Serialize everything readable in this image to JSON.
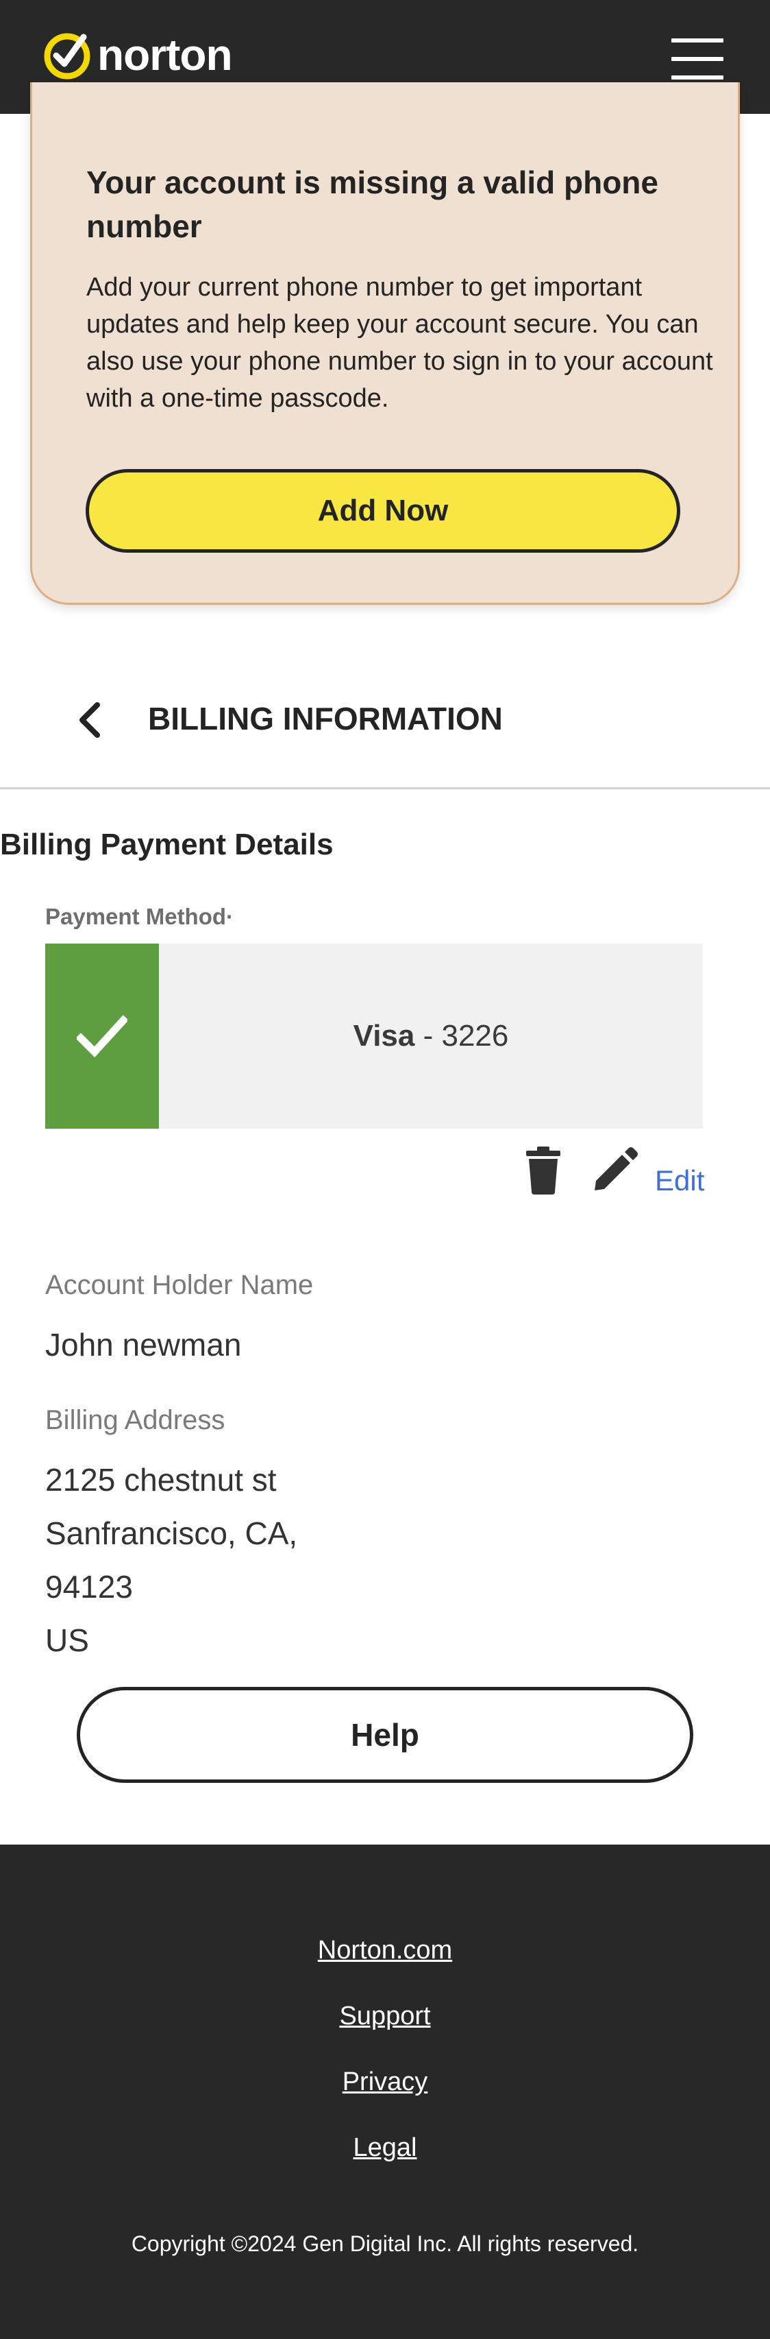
{
  "header": {
    "brand": "norton",
    "menu_icon": "hamburger-menu-icon"
  },
  "phone_alert": {
    "title": "Your account is missing a valid phone number",
    "body": "Add your current phone number to get important updates and help keep your account secure. You can also use your phone number to sign in to your account with a one-time passcode.",
    "button_label": "Add Now"
  },
  "billing": {
    "back_icon": "chevron-left-icon",
    "title": "BILLING INFORMATION",
    "section_heading": "Billing Payment Details",
    "payment_method_label": "Payment Method·",
    "payment": {
      "brand": "Visa",
      "separator": " - ",
      "last4": "3226",
      "selected_icon": "check-icon"
    },
    "actions": {
      "delete_icon": "trash-icon",
      "edit_icon": "pencil-icon",
      "edit_label": "Edit"
    },
    "account_holder_label": "Account Holder Name",
    "account_holder_value": "John newman",
    "billing_address_label": "Billing Address",
    "address_lines": [
      "2125 chestnut st",
      "Sanfrancisco, CA,",
      "94123",
      "US"
    ],
    "help_label": "Help"
  },
  "footer": {
    "links": [
      "Norton.com",
      "Support",
      "Privacy",
      "Legal"
    ],
    "copyright": "Copyright ©2024 Gen Digital Inc. All rights reserved."
  },
  "colors": {
    "header_bg": "#282828",
    "alert_bg": "#efe0d1",
    "alert_border": "#dcae85",
    "accent_yellow": "#f8e643",
    "success_green": "#5f9e40",
    "link_blue": "#3c6fd8"
  }
}
